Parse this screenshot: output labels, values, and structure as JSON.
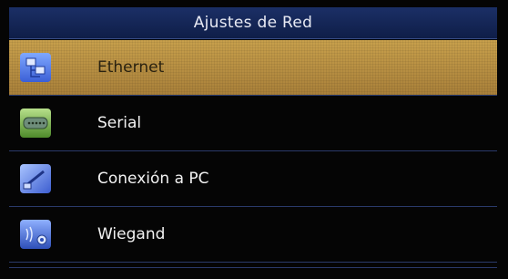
{
  "header": {
    "title": "Ajustes de Red"
  },
  "menu": {
    "items": [
      {
        "label": "Ethernet",
        "icon": "ethernet-network-icon",
        "selected": true
      },
      {
        "label": "Serial",
        "icon": "serial-port-icon",
        "selected": false
      },
      {
        "label": "Conexión a PC",
        "icon": "pc-connection-icon",
        "selected": false
      },
      {
        "label": "Wiegand",
        "icon": "wiegand-gear-icon",
        "selected": false
      }
    ]
  },
  "colors": {
    "title_bar": "#1b2f66",
    "selected_row": "#c8a04c",
    "background": "#050505",
    "divider": "#2a3a6a"
  }
}
